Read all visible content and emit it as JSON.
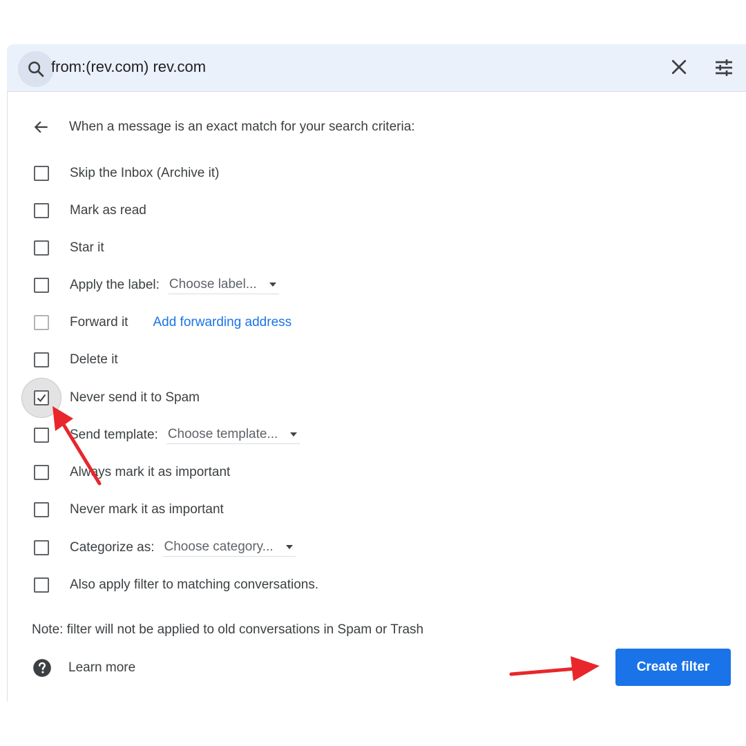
{
  "search": {
    "query": "from:(rev.com) rev.com",
    "icons": {
      "search": "search-icon",
      "clear": "close-icon",
      "options": "tune-icon"
    }
  },
  "filter_panel": {
    "header": "When a message is an exact match for your search criteria:",
    "options": [
      {
        "label": "Skip the Inbox (Archive it)",
        "checked": false
      },
      {
        "label": "Mark as read",
        "checked": false
      },
      {
        "label": "Star it",
        "checked": false
      },
      {
        "label": "Apply the label:",
        "select": "Choose label...",
        "checked": false
      },
      {
        "label": "Forward it",
        "link": "Add forwarding address",
        "checked": false,
        "disabled": true
      },
      {
        "label": "Delete it",
        "checked": false
      },
      {
        "label": "Never send it to Spam",
        "checked": true
      },
      {
        "label": "Send template:",
        "select": "Choose template...",
        "checked": false
      },
      {
        "label": "Always mark it as important",
        "checked": false
      },
      {
        "label": "Never mark it as important",
        "checked": false
      },
      {
        "label": "Categorize as:",
        "select": "Choose category...",
        "checked": false
      },
      {
        "label": "Also apply filter to matching conversations.",
        "checked": false
      }
    ],
    "note": "Note: filter will not be applied to old conversations in Spam or Trash",
    "learn_more": "Learn more",
    "create_button": "Create filter"
  },
  "colors": {
    "accent": "#1a73e8",
    "search_bg": "#eaf1fb",
    "annotation_arrow": "#e8262b"
  }
}
